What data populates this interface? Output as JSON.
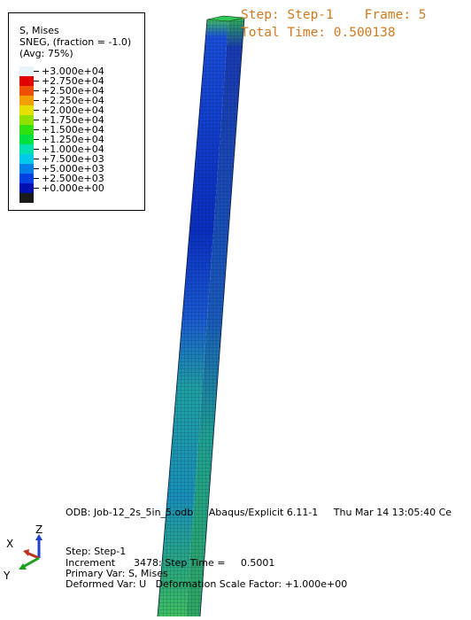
{
  "legend": {
    "title": "S, Mises",
    "subtitle": "SNEG, (fraction = -1.0)",
    "avg": "(Avg: 75%)",
    "entries": [
      {
        "label": "+3.000e+04",
        "color": "#e8f4fa"
      },
      {
        "label": "+2.750e+04",
        "color": "#e00000"
      },
      {
        "label": "+2.500e+04",
        "color": "#ee5000"
      },
      {
        "label": "+2.250e+04",
        "color": "#f2a000"
      },
      {
        "label": "+2.000e+04",
        "color": "#e6e000"
      },
      {
        "label": "+1.750e+04",
        "color": "#90e000"
      },
      {
        "label": "+1.500e+04",
        "color": "#30e010"
      },
      {
        "label": "+1.250e+04",
        "color": "#00e040"
      },
      {
        "label": "+1.000e+04",
        "color": "#00e0b0"
      },
      {
        "label": "+7.500e+03",
        "color": "#00c8e8"
      },
      {
        "label": "+5.000e+03",
        "color": "#0080e8"
      },
      {
        "label": "+2.500e+03",
        "color": "#0040e0"
      },
      {
        "label": "+0.000e+00",
        "color": "#0010b0"
      },
      {
        "label": "",
        "color": "#1a1a1a"
      }
    ]
  },
  "header": {
    "step_line": "Step: Step-1    Frame: 5",
    "time_line": "Total Time: 0.500138"
  },
  "footer": {
    "odb_line": "ODB: Job-12_2s_5in_5.odb     Abaqus/Explicit 6.11-1     Thu Mar 14 13:05:40 Ce",
    "step": "Step: Step-1",
    "increment": "Increment      3478: Step Time =     0.5001",
    "primary": "Primary Var: S, Mises",
    "deformed": "Deformed Var: U   Deformation Scale Factor: +1.000e+00"
  },
  "triad": {
    "x": "X",
    "y": "Y",
    "z": "Z",
    "x_color": "#c03020",
    "y_color": "#20a020",
    "z_color": "#2040d0"
  }
}
